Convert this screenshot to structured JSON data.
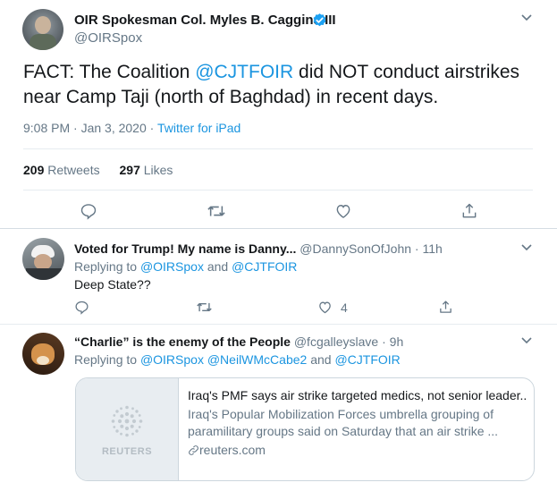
{
  "main_tweet": {
    "author_name": "OIR Spokesman Col. Myles B. Caggins III",
    "handle": "@OIRSpox",
    "text_prefix": "FACT: The Coalition ",
    "mention": "@CJTFOIR",
    "text_suffix": " did NOT conduct airstrikes near Camp Taji (north of Baghdad) in recent days.",
    "timestamp": "9:08 PM · Jan 3, 2020",
    "separator": " · ",
    "source": "Twitter for iPad",
    "retweets_count": "209",
    "retweets_label": "Retweets",
    "likes_count": "297",
    "likes_label": "Likes"
  },
  "replies": [
    {
      "author_name": "Voted for Trump! My name is Danny...",
      "handle": "@DannySonOfJohn",
      "time": "· 11h",
      "replying_label": "Replying to ",
      "reply_mention_1": "@OIRSpox",
      "reply_and": " and ",
      "reply_mention_2": "@CJTFOIR",
      "text": "Deep State??",
      "like_count": "4"
    },
    {
      "author_name": "“Charlie” is the enemy of the People",
      "handle": "@fcgalleyslave",
      "time": "· 9h",
      "replying_label": "Replying to ",
      "reply_mention_1": "@OIRSpox",
      "reply_space": " ",
      "reply_mention_2": "@NeilWMcCabe2",
      "reply_and": " and ",
      "reply_mention_3": "@CJTFOIR",
      "card": {
        "thumb_label": "REUTERS",
        "title": "Iraq's PMF says air strike targeted medics, not senior leader...",
        "description": "Iraq's Popular Mobilization Forces umbrella grouping of paramilitary groups said on Saturday that an air strike ...",
        "domain": "reuters.com"
      }
    }
  ],
  "icons": {
    "verified": "verified-badge-icon",
    "chevron": "chevron-down-icon",
    "reply": "reply-icon",
    "retweet": "retweet-icon",
    "like": "like-icon",
    "share": "share-icon",
    "link": "link-icon"
  },
  "colors": {
    "accent": "#1b95e0",
    "muted": "#657786",
    "border": "#e6ecf0"
  }
}
